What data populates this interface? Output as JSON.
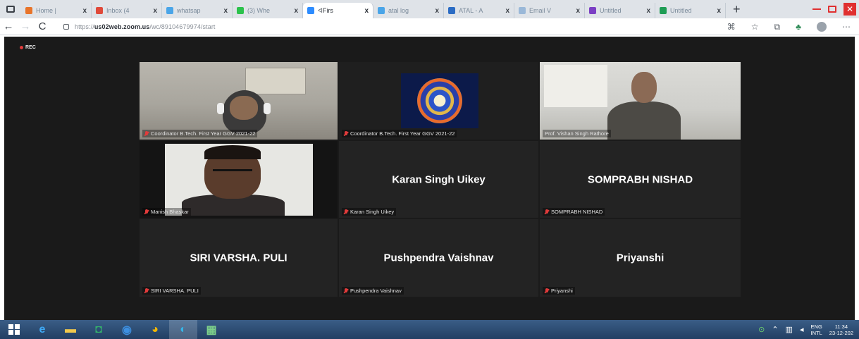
{
  "browser": {
    "tabs": [
      {
        "label": "Home |",
        "favicon_color": "#e8742a",
        "active": false
      },
      {
        "label": "Inbox (4",
        "favicon_color": "#e04a3a",
        "active": false
      },
      {
        "label": "whatsap",
        "favicon_color": "#4aa5e8",
        "active": false
      },
      {
        "label": "(3) Whe",
        "favicon_color": "#2cc24c",
        "active": false
      },
      {
        "label": "Firs",
        "favicon_color": "#2d8cff",
        "active": true
      },
      {
        "label": "atal log",
        "favicon_color": "#4aa5e8",
        "active": false
      },
      {
        "label": "ATAL - A",
        "favicon_color": "#2b6cc4",
        "active": false
      },
      {
        "label": "Email V",
        "favicon_color": "#9ab8d8",
        "active": false
      },
      {
        "label": "Untitled",
        "favicon_color": "#7b3fc4",
        "active": false
      },
      {
        "label": "Untitled",
        "favicon_color": "#1f9d55",
        "active": false
      }
    ],
    "new_tab": "+",
    "close_glyph": "x",
    "url_prefix": "https://",
    "url_host": "us02web.zoom.us",
    "url_path": "/wc/89104679974/start",
    "nav": {
      "back": "←",
      "forward": "→",
      "reload": "C"
    }
  },
  "zoom": {
    "recording_label": "REC",
    "accent_speaking": "#c7e37a",
    "participants": [
      {
        "display": "video",
        "scene": "room",
        "label": "Coordinator B.Tech. First Year GGV 2021-22",
        "muted": true,
        "speaking": false
      },
      {
        "display": "logo",
        "scene": "logo",
        "label": "Coordinator B.Tech. First Year GGV 2021-22",
        "muted": true,
        "speaking": false
      },
      {
        "display": "video",
        "scene": "office",
        "label": "Prof. Vishan Singh Rathore",
        "muted": false,
        "speaking": true
      },
      {
        "display": "video",
        "scene": "dark",
        "label": "Manish Bhaskar",
        "muted": true,
        "speaking": false
      },
      {
        "display": "name",
        "big_name": "Karan Singh Uikey",
        "label": "Karan Singh Uikey",
        "muted": true,
        "speaking": false
      },
      {
        "display": "name",
        "big_name": "SOMPRABH NISHAD",
        "label": "SOMPRABH NISHAD",
        "muted": true,
        "speaking": false
      },
      {
        "display": "name",
        "big_name": "SIRI VARSHA. PULI",
        "label": "SIRI VARSHA. PULI",
        "muted": true,
        "speaking": false
      },
      {
        "display": "name",
        "big_name": "Pushpendra Vaishnav",
        "label": "Pushpendra Vaishnav",
        "muted": true,
        "speaking": false
      },
      {
        "display": "name",
        "big_name": "Priyanshi",
        "label": "Priyanshi",
        "muted": true,
        "speaking": false
      }
    ]
  },
  "taskbar": {
    "apps": [
      {
        "name": "internet-explorer-icon",
        "glyph": "e",
        "color": "#3fa9f5",
        "active": false
      },
      {
        "name": "file-explorer-icon",
        "glyph": "▬",
        "color": "#f2c94c",
        "active": false
      },
      {
        "name": "store-icon",
        "glyph": "◘",
        "color": "#35b36b",
        "active": false
      },
      {
        "name": "photos-icon",
        "glyph": "◉",
        "color": "#3d8fe0",
        "active": false
      },
      {
        "name": "chrome-icon",
        "glyph": "◕",
        "color": "#f2b705",
        "active": false
      },
      {
        "name": "edge-icon",
        "glyph": "◐",
        "color": "#36b6e8",
        "active": true
      },
      {
        "name": "excel-icon",
        "glyph": "▦",
        "color": "#7dd08a",
        "active": false
      }
    ],
    "lang": [
      "ENG",
      "INTL"
    ],
    "time": "11:34",
    "date": "23-12-202"
  }
}
